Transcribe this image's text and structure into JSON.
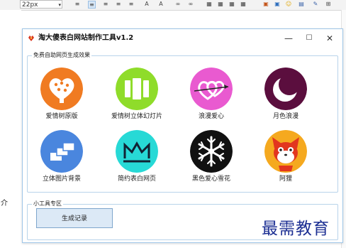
{
  "editor": {
    "font_size": "22px",
    "side_text": "介"
  },
  "window": {
    "title": "淘大傻表白网站制作工具v1.2",
    "controls": {
      "minimize": "—",
      "maximize": "☐",
      "close": "✕"
    }
  },
  "section_features": {
    "label": "免费自助网页生成效果",
    "items": [
      {
        "label": "爱情树原版",
        "icon": "tree-heart-icon",
        "color": "#f07b22"
      },
      {
        "label": "爱情树立体幻灯片",
        "icon": "slideshow-icon",
        "color": "#8fdc2a"
      },
      {
        "label": "浪漫爱心",
        "icon": "heart-arrow-icon",
        "color": "#e95ad0"
      },
      {
        "label": "月色浪漫",
        "icon": "moon-icon",
        "color": "#5b0e3e"
      },
      {
        "label": "立体图片背景",
        "icon": "cards-icon",
        "color": "#4a86de"
      },
      {
        "label": "简约表白网页",
        "icon": "crown-icon",
        "color": "#27d9d6"
      },
      {
        "label": "黑色爱心雪花",
        "icon": "snowflake-icon",
        "color": "#111111"
      },
      {
        "label": "阿狸",
        "icon": "fox-icon",
        "color": "#f5a91f"
      }
    ]
  },
  "section_tools": {
    "label": "小工具专区",
    "generate_button": "生成记录"
  },
  "watermark": "最需教育"
}
